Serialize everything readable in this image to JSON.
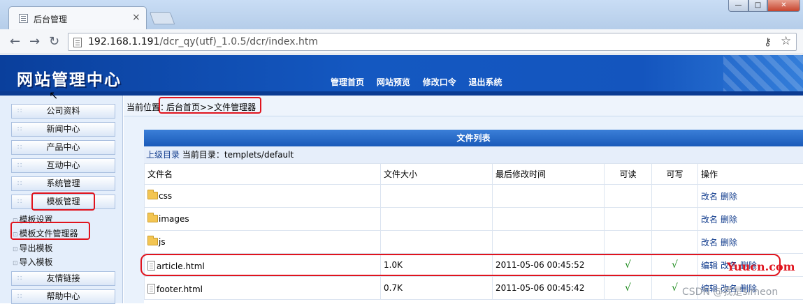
{
  "browser": {
    "tab_title": "后台管理",
    "tab_close": "×",
    "win_min": "—",
    "win_max": "□",
    "win_close": "✕",
    "url_host": "192.168.1.191",
    "url_path": "/dcr_qy(utf)_1.0.5/dcr/index.htm"
  },
  "header": {
    "logo": "网站管理中心",
    "nav": [
      "管理首页",
      "网站预览",
      "修改口令",
      "退出系统"
    ]
  },
  "sidebar": {
    "buttons": [
      "公司资料",
      "新闻中心",
      "产品中心",
      "互动中心",
      "系统管理",
      "模板管理"
    ],
    "sub_items": [
      "模板设置",
      "模板文件管理器",
      "导出模板",
      "导入模板"
    ],
    "bottom_buttons": [
      "友情链接",
      "帮助中心"
    ]
  },
  "breadcrumb": {
    "label": "当前位置：",
    "path": "后台首页>>文件管理器"
  },
  "file_panel": {
    "title": "文件列表",
    "up_dir": "上级目录",
    "current_dir_label": "当前目录：",
    "current_dir": "templets/default",
    "columns": [
      "文件名",
      "文件大小",
      "最后修改时间",
      "可读",
      "可写",
      "操作"
    ],
    "rows": [
      {
        "type": "folder",
        "name": "css",
        "size": "",
        "mtime": "",
        "read": "",
        "write": "",
        "actions": [
          "改名",
          "删除"
        ]
      },
      {
        "type": "folder",
        "name": "images",
        "size": "",
        "mtime": "",
        "read": "",
        "write": "",
        "actions": [
          "改名",
          "删除"
        ]
      },
      {
        "type": "folder",
        "name": "js",
        "size": "",
        "mtime": "",
        "read": "",
        "write": "",
        "actions": [
          "改名",
          "删除"
        ]
      },
      {
        "type": "file",
        "name": "article.html",
        "size": "1.0K",
        "mtime": "2011-05-06 00:45:52",
        "read": "√",
        "write": "√",
        "actions": [
          "编辑",
          "改名",
          "删除"
        ]
      },
      {
        "type": "file",
        "name": "footer.html",
        "size": "0.7K",
        "mtime": "2011-05-06 00:45:42",
        "read": "√",
        "write": "√",
        "actions": [
          "编辑",
          "改名",
          "删除"
        ]
      }
    ]
  },
  "watermarks": {
    "red": "Yuucn.com",
    "csdn": "CSDN @我是simeon"
  },
  "colors": {
    "header_blue": "#1458c1",
    "sidebar_bg": "#e4eefb",
    "highlight_red": "#e0141e"
  }
}
